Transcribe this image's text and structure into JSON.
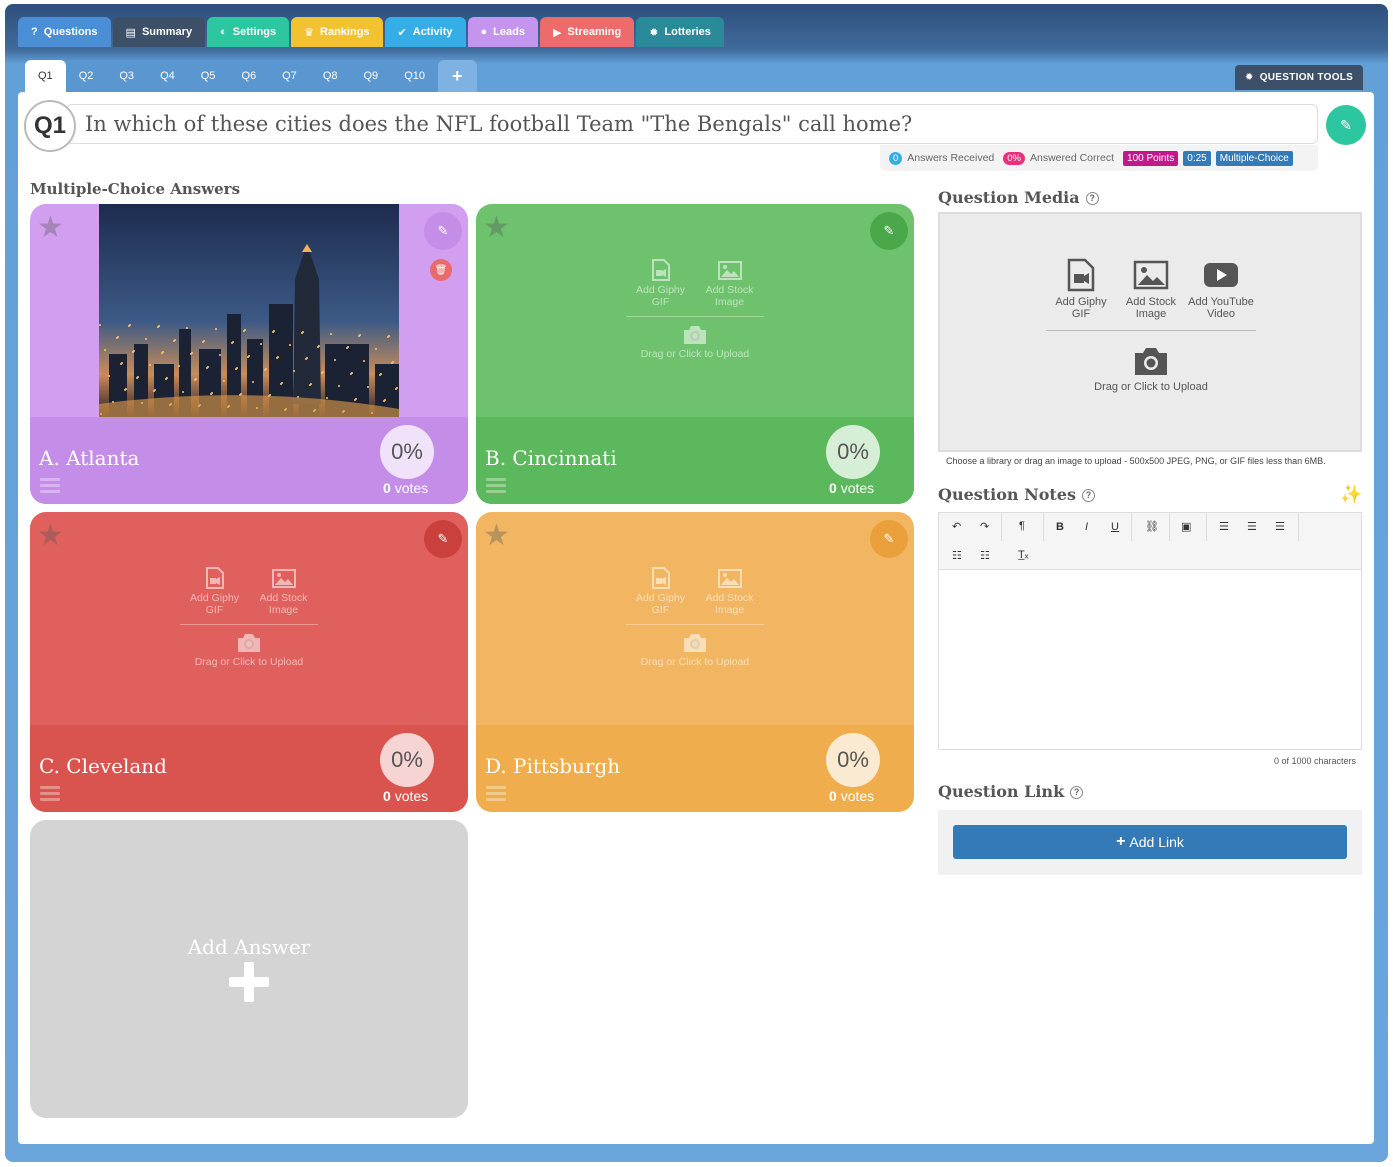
{
  "nav": {
    "tabs": [
      {
        "label": "Questions",
        "color": "#4a8fd6",
        "icon": "question-icon",
        "glyph": "?"
      },
      {
        "label": "Summary",
        "color": "#3d5068",
        "icon": "list-icon",
        "glyph": "▤"
      },
      {
        "label": "Settings",
        "color": "#2cc7a0",
        "icon": "toggle-icon",
        "glyph": "◐"
      },
      {
        "label": "Rankings",
        "color": "#f3c230",
        "icon": "trophy-icon",
        "glyph": "♛"
      },
      {
        "label": "Activity",
        "color": "#35aee8",
        "icon": "check-circle-icon",
        "glyph": "✔"
      },
      {
        "label": "Leads",
        "color": "#c495ee",
        "icon": "user-icon",
        "glyph": "●"
      },
      {
        "label": "Streaming",
        "color": "#ee6b6b",
        "icon": "video-camera-icon",
        "glyph": "▶"
      },
      {
        "label": "Lotteries",
        "color": "#2a8a9a",
        "icon": "gear-icon",
        "glyph": "✹"
      }
    ]
  },
  "question_tabs": [
    "Q1",
    "Q2",
    "Q3",
    "Q4",
    "Q5",
    "Q6",
    "Q7",
    "Q8",
    "Q9",
    "Q10"
  ],
  "question_tools_label": "QUESTION TOOLS",
  "question": {
    "number": "Q1",
    "text": "In which of these cities does the NFL football Team \"The Bengals\" call home?"
  },
  "stats": {
    "answers_received_count": "0",
    "answers_received_label": "Answers Received",
    "answered_correct_pct": "0%",
    "answered_correct_label": "Answered Correct",
    "points": "100 Points",
    "time": "0:25",
    "type": "Multiple-Choice"
  },
  "answers_title": "Multiple-Choice Answers",
  "answers": [
    {
      "label": "A. Atlanta",
      "pct": "0%",
      "votes": "0",
      "votes_word": "votes",
      "color_top": "#d19ef0",
      "color_bottom": "#c48ee8",
      "edit_color": "#c48ee8",
      "has_image": true
    },
    {
      "label": "B. Cincinnati",
      "pct": "0%",
      "votes": "0",
      "votes_word": "votes",
      "color_top": "#6ec26e",
      "color_bottom": "#5cb85c",
      "edit_color": "#4aa84a",
      "has_image": false
    },
    {
      "label": "C. Cleveland",
      "pct": "0%",
      "votes": "0",
      "votes_word": "votes",
      "color_top": "#e0605e",
      "color_bottom": "#d9534f",
      "edit_color": "#c9403c",
      "has_image": false
    },
    {
      "label": "D. Pittsburgh",
      "pct": "0%",
      "votes": "0",
      "votes_word": "votes",
      "color_top": "#f2b562",
      "color_bottom": "#f0ad4e",
      "edit_color": "#e9a03a",
      "has_image": false
    }
  ],
  "card_media": {
    "giphy": "Add Giphy GIF",
    "stock": "Add Stock Image",
    "upload": "Drag or Click to Upload"
  },
  "add_answer_label": "Add Answer",
  "media": {
    "title": "Question Media",
    "giphy": "Add Giphy GIF",
    "stock": "Add Stock Image",
    "youtube": "Add YouTube Video",
    "upload": "Drag or Click to Upload",
    "hint": "Choose a library or drag an image to upload - 500x500 JPEG, PNG, or GIF files less than 6MB."
  },
  "notes": {
    "title": "Question Notes",
    "char_count": "0 of 1000 characters"
  },
  "link": {
    "title": "Question Link",
    "button": "Add Link"
  }
}
